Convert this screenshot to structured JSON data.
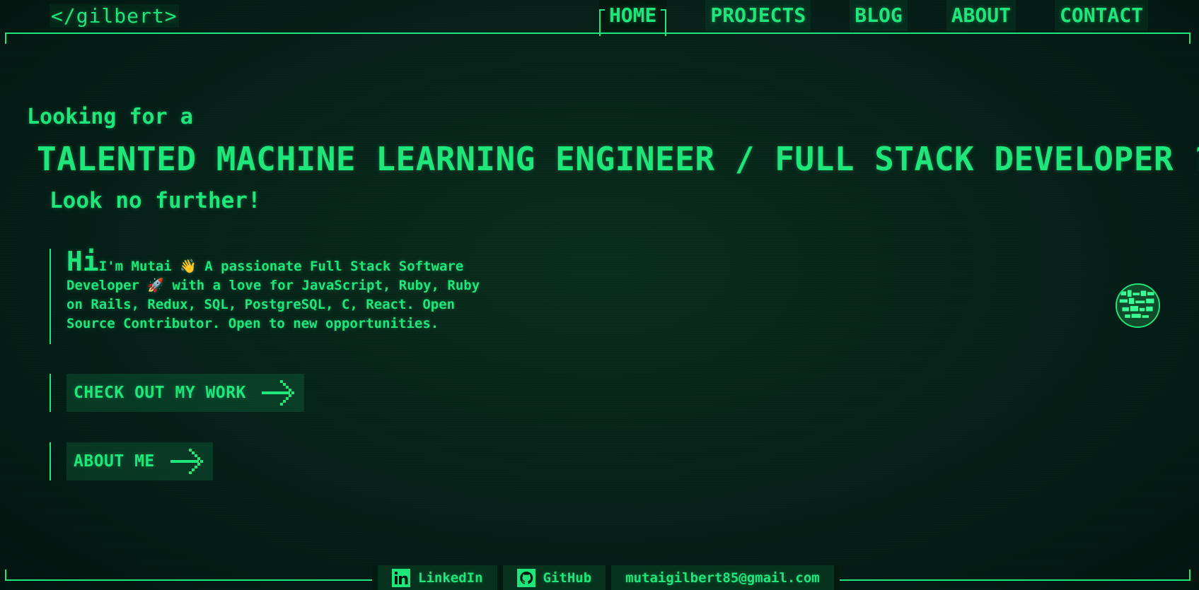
{
  "brand": {
    "logo": "</gilbert>"
  },
  "nav": {
    "items": [
      {
        "label": "HOME",
        "active": true
      },
      {
        "label": "PROJECTS",
        "active": false
      },
      {
        "label": "BLOG",
        "active": false
      },
      {
        "label": "ABOUT",
        "active": false
      },
      {
        "label": "CONTACT",
        "active": false
      }
    ]
  },
  "hero": {
    "intro": "Looking for a",
    "headline": "TALENTED MACHINE LEARNING ENGINEER / FULL STACK DEVELOPER ?",
    "tagline": "Look no further!",
    "bio_hi": "Hi",
    "bio_text": "I'm Mutai 👋 A passionate Full Stack Software Developer 🚀 with a love for JavaScript, Ruby, Ruby on Rails, Redux, SQL, PostgreSQL, C, React. Open Source Contributor. Open to new opportunities.",
    "cta_work": "CHECK OUT MY WORK",
    "cta_about": "ABOUT ME"
  },
  "footer": {
    "linkedin": "LinkedIn",
    "github": "GitHub",
    "email": "mutaigilbert85@gmail.com"
  },
  "colors": {
    "accent": "#1ee67a",
    "background": "#041a10"
  },
  "icons": [
    "linkedin-icon",
    "github-icon",
    "arrow-right-icon",
    "avatar"
  ]
}
